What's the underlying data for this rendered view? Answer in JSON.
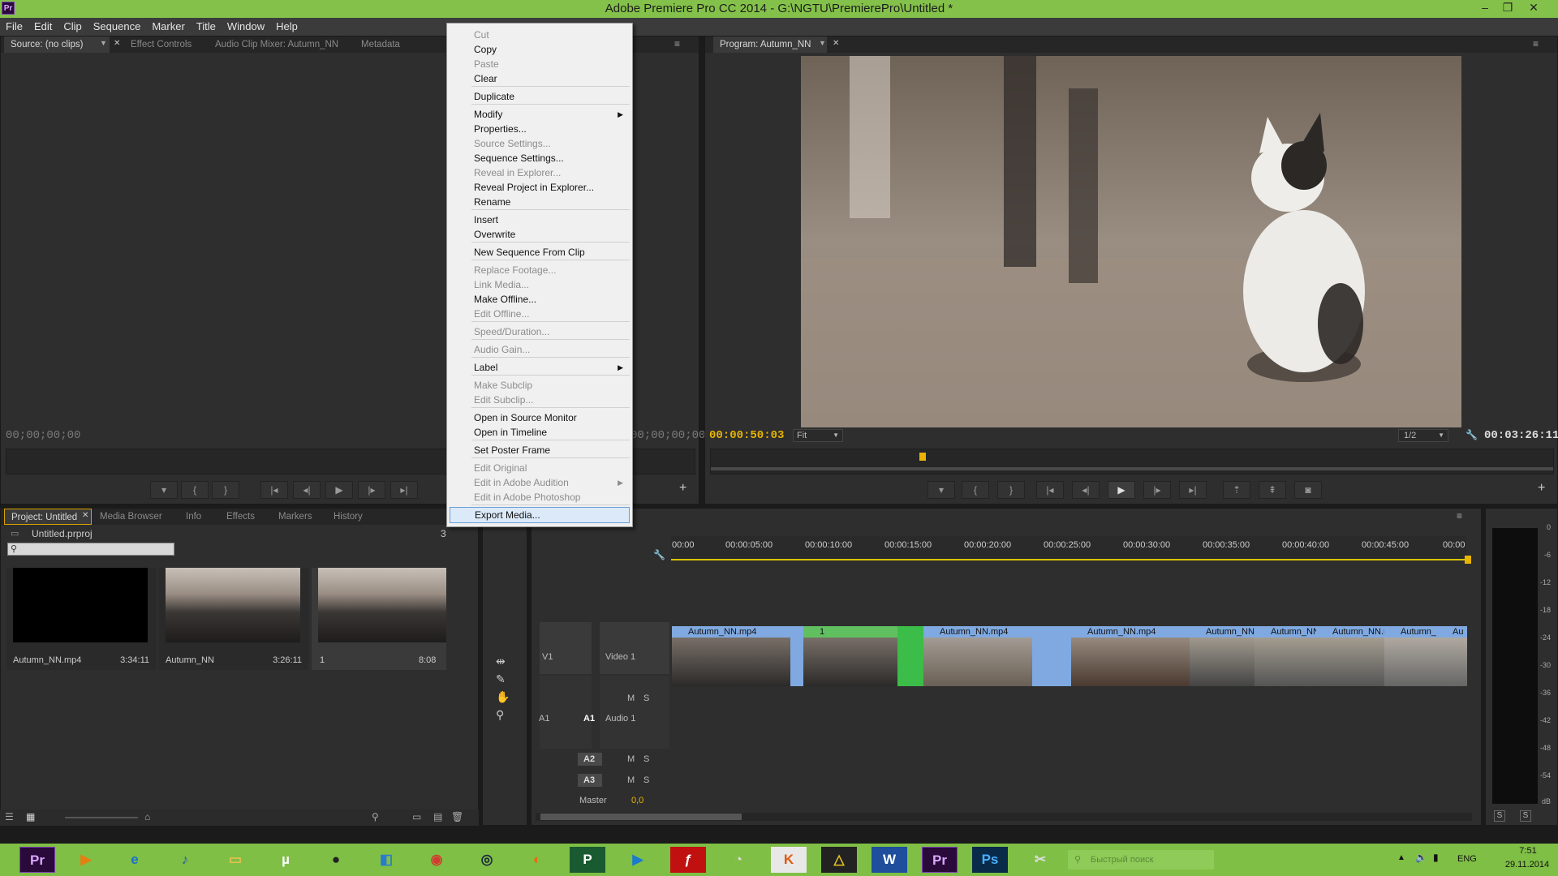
{
  "window": {
    "title": "Adobe Premiere Pro CC 2014 - G:\\NGTU\\PremierePro\\Untitled *",
    "app_icon": "Pr",
    "minimize": "–",
    "restore": "❐",
    "close": "✕"
  },
  "menu": [
    "File",
    "Edit",
    "Clip",
    "Sequence",
    "Marker",
    "Title",
    "Window",
    "Help"
  ],
  "source_panel": {
    "tabs": [
      "Source: (no clips)",
      "Effect Controls",
      "Audio Clip Mixer: Autumn_NN",
      "Metadata"
    ],
    "timecode_in": "00;00;00;00",
    "timecode_out": "00;00;00;00"
  },
  "program_panel": {
    "tab": "Program: Autumn_NN",
    "timecode": "00:00:50:03",
    "fit": "Fit",
    "resolution": "1/2",
    "duration": "00:03:26:11"
  },
  "project_panel": {
    "tabs": [
      "Project: Untitled",
      "Media Browser",
      "Info",
      "Effects",
      "Markers",
      "History"
    ],
    "file": "Untitled.prproj",
    "count": "3",
    "items": [
      {
        "name": "Autumn_NN.mp4",
        "duration": "3:34:11"
      },
      {
        "name": "Autumn_NN",
        "duration": "3:26:11"
      },
      {
        "name": "1",
        "duration": "8:08"
      }
    ]
  },
  "context_menu": {
    "items": [
      {
        "label": "Cut",
        "enabled": false
      },
      {
        "label": "Copy",
        "enabled": true
      },
      {
        "label": "Paste",
        "enabled": false
      },
      {
        "label": "Clear",
        "enabled": true
      },
      {
        "label": "Duplicate",
        "enabled": true
      },
      {
        "label": "Modify",
        "enabled": true,
        "submenu": true
      },
      {
        "label": "Properties...",
        "enabled": true
      },
      {
        "label": "Source Settings...",
        "enabled": false
      },
      {
        "label": "Sequence Settings...",
        "enabled": true
      },
      {
        "label": "Reveal in Explorer...",
        "enabled": false
      },
      {
        "label": "Reveal Project in Explorer...",
        "enabled": true
      },
      {
        "label": "Rename",
        "enabled": true
      },
      {
        "label": "Insert",
        "enabled": true
      },
      {
        "label": "Overwrite",
        "enabled": true
      },
      {
        "label": "New Sequence From Clip",
        "enabled": true
      },
      {
        "label": "Replace Footage...",
        "enabled": false
      },
      {
        "label": "Link Media...",
        "enabled": false
      },
      {
        "label": "Make Offline...",
        "enabled": true
      },
      {
        "label": "Edit Offline...",
        "enabled": false
      },
      {
        "label": "Speed/Duration...",
        "enabled": false
      },
      {
        "label": "Audio Gain...",
        "enabled": false
      },
      {
        "label": "Label",
        "enabled": true,
        "submenu": true
      },
      {
        "label": "Make Subclip",
        "enabled": false
      },
      {
        "label": "Edit Subclip...",
        "enabled": false
      },
      {
        "label": "Open in Source Monitor",
        "enabled": true
      },
      {
        "label": "Open in Timeline",
        "enabled": true
      },
      {
        "label": "Set Poster Frame",
        "enabled": true
      },
      {
        "label": "Edit Original",
        "enabled": false
      },
      {
        "label": "Edit in Adobe Audition",
        "enabled": false,
        "submenu": true
      },
      {
        "label": "Edit in Adobe Photoshop",
        "enabled": false
      },
      {
        "label": "Export Media...",
        "enabled": true,
        "highlighted": true
      }
    ]
  },
  "timeline": {
    "ruler": [
      "00:00",
      "00:00:05:00",
      "00:00:10:00",
      "00:00:15:00",
      "00:00:20:00",
      "00:00:25:00",
      "00:00:30:00",
      "00:00:35:00",
      "00:00:40:00",
      "00:00:45:00",
      "00:00"
    ],
    "tracks": {
      "v1": "V1",
      "video1": "Video 1",
      "a1": "A1",
      "audio1": "Audio 1",
      "a2": "A2",
      "a3": "A3",
      "master": "Master",
      "master_val": "0,0",
      "m": "M",
      "s": "S"
    },
    "clips": [
      "Autumn_NN.mp4",
      "1",
      "Autumn_NN.mp4",
      "Autumn_NN.mp4",
      "Autumn_NN.m",
      "Autumn_NN.",
      "Autumn_NN.m",
      "Autumn_N",
      "Au"
    ]
  },
  "vu_meter": {
    "scale": [
      "0",
      "-6",
      "-12",
      "-18",
      "-24",
      "-30",
      "-36",
      "-42",
      "-48",
      "-54",
      "dB"
    ],
    "buttons": [
      "S",
      "S"
    ]
  },
  "taskbar": {
    "search_placeholder": "Быстрый поиск",
    "lang": "ENG",
    "time": "7:51",
    "date": "29.11.2014"
  }
}
